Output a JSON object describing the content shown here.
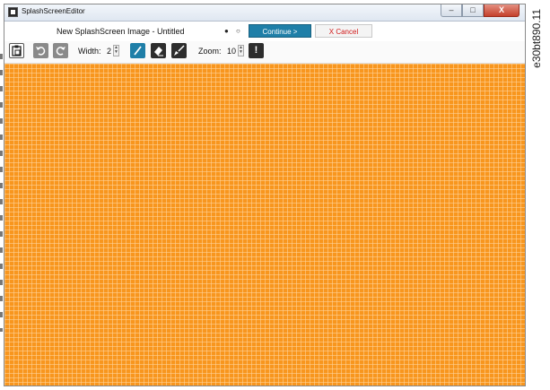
{
  "window": {
    "title": "SplashScreenEditor",
    "controls": {
      "minimize": "–",
      "maximize": "□",
      "close": "X"
    }
  },
  "header": {
    "document_title": "New SplashScreen Image - Untitled",
    "page_indicator": "● ○",
    "continue_label": "Continue >",
    "cancel_label": "X Cancel"
  },
  "toolbar": {
    "width_label": "Width:",
    "width_value": "2",
    "zoom_label": "Zoom:",
    "zoom_value": "10",
    "info_label": "!",
    "icons": [
      "clipboard-icon",
      "undo-icon",
      "redo-icon",
      "pencil-icon",
      "eraser-icon",
      "brush-icon",
      "exclamation-icon"
    ]
  },
  "canvas": {
    "fill_color": "#f8961e",
    "grid_color": "#ffd6a0"
  },
  "accent_colors": {
    "primary": "#1f7fa8",
    "cancel_text": "#d11a1a"
  },
  "side_code": "e30bt890.11"
}
